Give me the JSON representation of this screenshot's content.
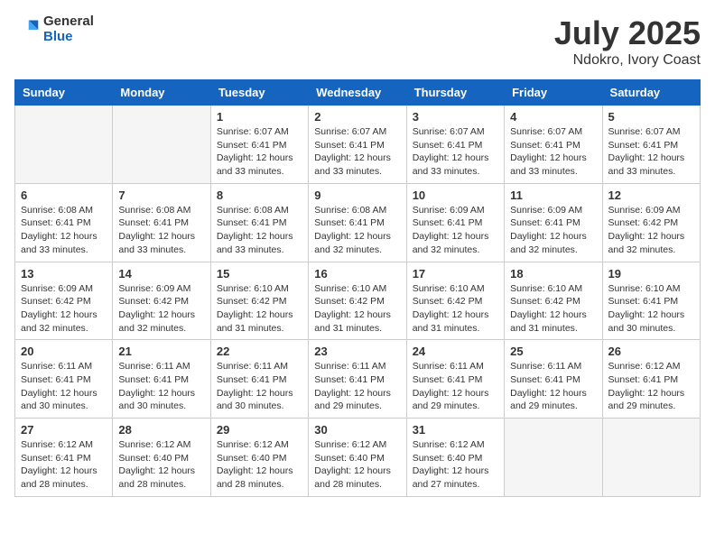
{
  "header": {
    "logo_general": "General",
    "logo_blue": "Blue",
    "title": "July 2025",
    "subtitle": "Ndokro, Ivory Coast"
  },
  "weekdays": [
    "Sunday",
    "Monday",
    "Tuesday",
    "Wednesday",
    "Thursday",
    "Friday",
    "Saturday"
  ],
  "weeks": [
    [
      {
        "day": "",
        "empty": true
      },
      {
        "day": "",
        "empty": true
      },
      {
        "day": "1",
        "sunrise": "Sunrise: 6:07 AM",
        "sunset": "Sunset: 6:41 PM",
        "daylight": "Daylight: 12 hours and 33 minutes."
      },
      {
        "day": "2",
        "sunrise": "Sunrise: 6:07 AM",
        "sunset": "Sunset: 6:41 PM",
        "daylight": "Daylight: 12 hours and 33 minutes."
      },
      {
        "day": "3",
        "sunrise": "Sunrise: 6:07 AM",
        "sunset": "Sunset: 6:41 PM",
        "daylight": "Daylight: 12 hours and 33 minutes."
      },
      {
        "day": "4",
        "sunrise": "Sunrise: 6:07 AM",
        "sunset": "Sunset: 6:41 PM",
        "daylight": "Daylight: 12 hours and 33 minutes."
      },
      {
        "day": "5",
        "sunrise": "Sunrise: 6:07 AM",
        "sunset": "Sunset: 6:41 PM",
        "daylight": "Daylight: 12 hours and 33 minutes."
      }
    ],
    [
      {
        "day": "6",
        "sunrise": "Sunrise: 6:08 AM",
        "sunset": "Sunset: 6:41 PM",
        "daylight": "Daylight: 12 hours and 33 minutes."
      },
      {
        "day": "7",
        "sunrise": "Sunrise: 6:08 AM",
        "sunset": "Sunset: 6:41 PM",
        "daylight": "Daylight: 12 hours and 33 minutes."
      },
      {
        "day": "8",
        "sunrise": "Sunrise: 6:08 AM",
        "sunset": "Sunset: 6:41 PM",
        "daylight": "Daylight: 12 hours and 33 minutes."
      },
      {
        "day": "9",
        "sunrise": "Sunrise: 6:08 AM",
        "sunset": "Sunset: 6:41 PM",
        "daylight": "Daylight: 12 hours and 32 minutes."
      },
      {
        "day": "10",
        "sunrise": "Sunrise: 6:09 AM",
        "sunset": "Sunset: 6:41 PM",
        "daylight": "Daylight: 12 hours and 32 minutes."
      },
      {
        "day": "11",
        "sunrise": "Sunrise: 6:09 AM",
        "sunset": "Sunset: 6:41 PM",
        "daylight": "Daylight: 12 hours and 32 minutes."
      },
      {
        "day": "12",
        "sunrise": "Sunrise: 6:09 AM",
        "sunset": "Sunset: 6:42 PM",
        "daylight": "Daylight: 12 hours and 32 minutes."
      }
    ],
    [
      {
        "day": "13",
        "sunrise": "Sunrise: 6:09 AM",
        "sunset": "Sunset: 6:42 PM",
        "daylight": "Daylight: 12 hours and 32 minutes."
      },
      {
        "day": "14",
        "sunrise": "Sunrise: 6:09 AM",
        "sunset": "Sunset: 6:42 PM",
        "daylight": "Daylight: 12 hours and 32 minutes."
      },
      {
        "day": "15",
        "sunrise": "Sunrise: 6:10 AM",
        "sunset": "Sunset: 6:42 PM",
        "daylight": "Daylight: 12 hours and 31 minutes."
      },
      {
        "day": "16",
        "sunrise": "Sunrise: 6:10 AM",
        "sunset": "Sunset: 6:42 PM",
        "daylight": "Daylight: 12 hours and 31 minutes."
      },
      {
        "day": "17",
        "sunrise": "Sunrise: 6:10 AM",
        "sunset": "Sunset: 6:42 PM",
        "daylight": "Daylight: 12 hours and 31 minutes."
      },
      {
        "day": "18",
        "sunrise": "Sunrise: 6:10 AM",
        "sunset": "Sunset: 6:42 PM",
        "daylight": "Daylight: 12 hours and 31 minutes."
      },
      {
        "day": "19",
        "sunrise": "Sunrise: 6:10 AM",
        "sunset": "Sunset: 6:41 PM",
        "daylight": "Daylight: 12 hours and 30 minutes."
      }
    ],
    [
      {
        "day": "20",
        "sunrise": "Sunrise: 6:11 AM",
        "sunset": "Sunset: 6:41 PM",
        "daylight": "Daylight: 12 hours and 30 minutes."
      },
      {
        "day": "21",
        "sunrise": "Sunrise: 6:11 AM",
        "sunset": "Sunset: 6:41 PM",
        "daylight": "Daylight: 12 hours and 30 minutes."
      },
      {
        "day": "22",
        "sunrise": "Sunrise: 6:11 AM",
        "sunset": "Sunset: 6:41 PM",
        "daylight": "Daylight: 12 hours and 30 minutes."
      },
      {
        "day": "23",
        "sunrise": "Sunrise: 6:11 AM",
        "sunset": "Sunset: 6:41 PM",
        "daylight": "Daylight: 12 hours and 29 minutes."
      },
      {
        "day": "24",
        "sunrise": "Sunrise: 6:11 AM",
        "sunset": "Sunset: 6:41 PM",
        "daylight": "Daylight: 12 hours and 29 minutes."
      },
      {
        "day": "25",
        "sunrise": "Sunrise: 6:11 AM",
        "sunset": "Sunset: 6:41 PM",
        "daylight": "Daylight: 12 hours and 29 minutes."
      },
      {
        "day": "26",
        "sunrise": "Sunrise: 6:12 AM",
        "sunset": "Sunset: 6:41 PM",
        "daylight": "Daylight: 12 hours and 29 minutes."
      }
    ],
    [
      {
        "day": "27",
        "sunrise": "Sunrise: 6:12 AM",
        "sunset": "Sunset: 6:41 PM",
        "daylight": "Daylight: 12 hours and 28 minutes."
      },
      {
        "day": "28",
        "sunrise": "Sunrise: 6:12 AM",
        "sunset": "Sunset: 6:40 PM",
        "daylight": "Daylight: 12 hours and 28 minutes."
      },
      {
        "day": "29",
        "sunrise": "Sunrise: 6:12 AM",
        "sunset": "Sunset: 6:40 PM",
        "daylight": "Daylight: 12 hours and 28 minutes."
      },
      {
        "day": "30",
        "sunrise": "Sunrise: 6:12 AM",
        "sunset": "Sunset: 6:40 PM",
        "daylight": "Daylight: 12 hours and 28 minutes."
      },
      {
        "day": "31",
        "sunrise": "Sunrise: 6:12 AM",
        "sunset": "Sunset: 6:40 PM",
        "daylight": "Daylight: 12 hours and 27 minutes."
      },
      {
        "day": "",
        "empty": true
      },
      {
        "day": "",
        "empty": true
      }
    ]
  ]
}
